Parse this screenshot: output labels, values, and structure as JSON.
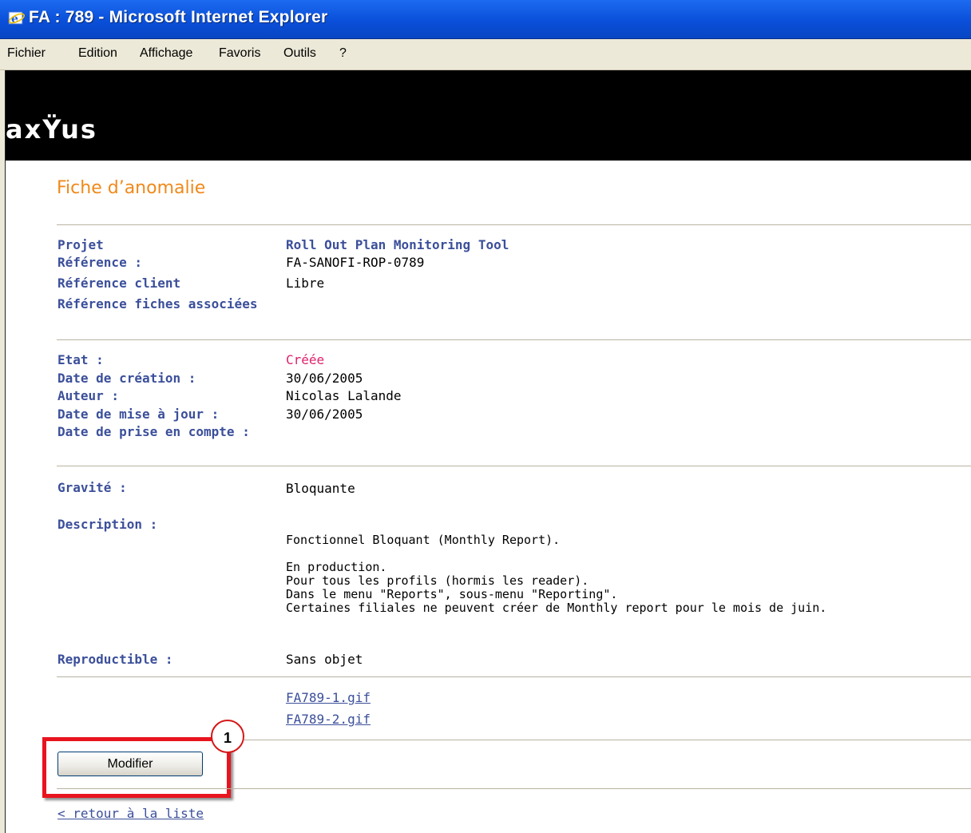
{
  "window": {
    "title": "FA : 789 - Microsoft Internet Explorer"
  },
  "menu": [
    "Fichier",
    "Edition",
    "Affichage",
    "Favoris",
    "Outils",
    "?"
  ],
  "brand": {
    "logo": "axŸus"
  },
  "page": {
    "title": "Fiche d’anomalie"
  },
  "section1": {
    "project_label": "Projet",
    "project_value": "Roll Out Plan Monitoring Tool",
    "ref_label": "Référence :",
    "ref_value": "FA-SANOFI-ROP-0789",
    "client_ref_label": "Référence client",
    "client_ref_value": "Libre",
    "linked_ref_label": "Référence fiches associées"
  },
  "section2": {
    "state_label": "Etat :",
    "state_value": "Créée",
    "created_label": "Date de création :",
    "created_value": "30/06/2005",
    "author_label": "Auteur :",
    "author_value": "Nicolas Lalande",
    "updated_label": "Date de mise à jour :",
    "updated_value": "30/06/2005",
    "taken_label": "Date de prise en compte :"
  },
  "section3": {
    "severity_label": "Gravité :",
    "severity_value": "Bloquante",
    "description_label": "Description :",
    "description_text": "Fonctionnel Bloquant (Monthly Report).\n\nEn production.\nPour tous les profils (hormis les reader).\nDans le menu \"Reports\", sous-menu \"Reporting\".\nCertaines filiales ne peuvent créer de Monthly report pour le mois de juin.",
    "reproducible_label": "Reproductible :",
    "reproducible_value": "Sans objet"
  },
  "attachments": [
    "FA789-1.gif",
    "FA789-2.gif"
  ],
  "actions": {
    "modify_label": "Modifier",
    "callout_number": "1"
  },
  "footer": {
    "back_link": "< retour à la liste"
  },
  "colors": {
    "accent": "#f0891a",
    "label": "#3b4f9a",
    "state": "#e0206a",
    "highlight": "#e8141e"
  }
}
